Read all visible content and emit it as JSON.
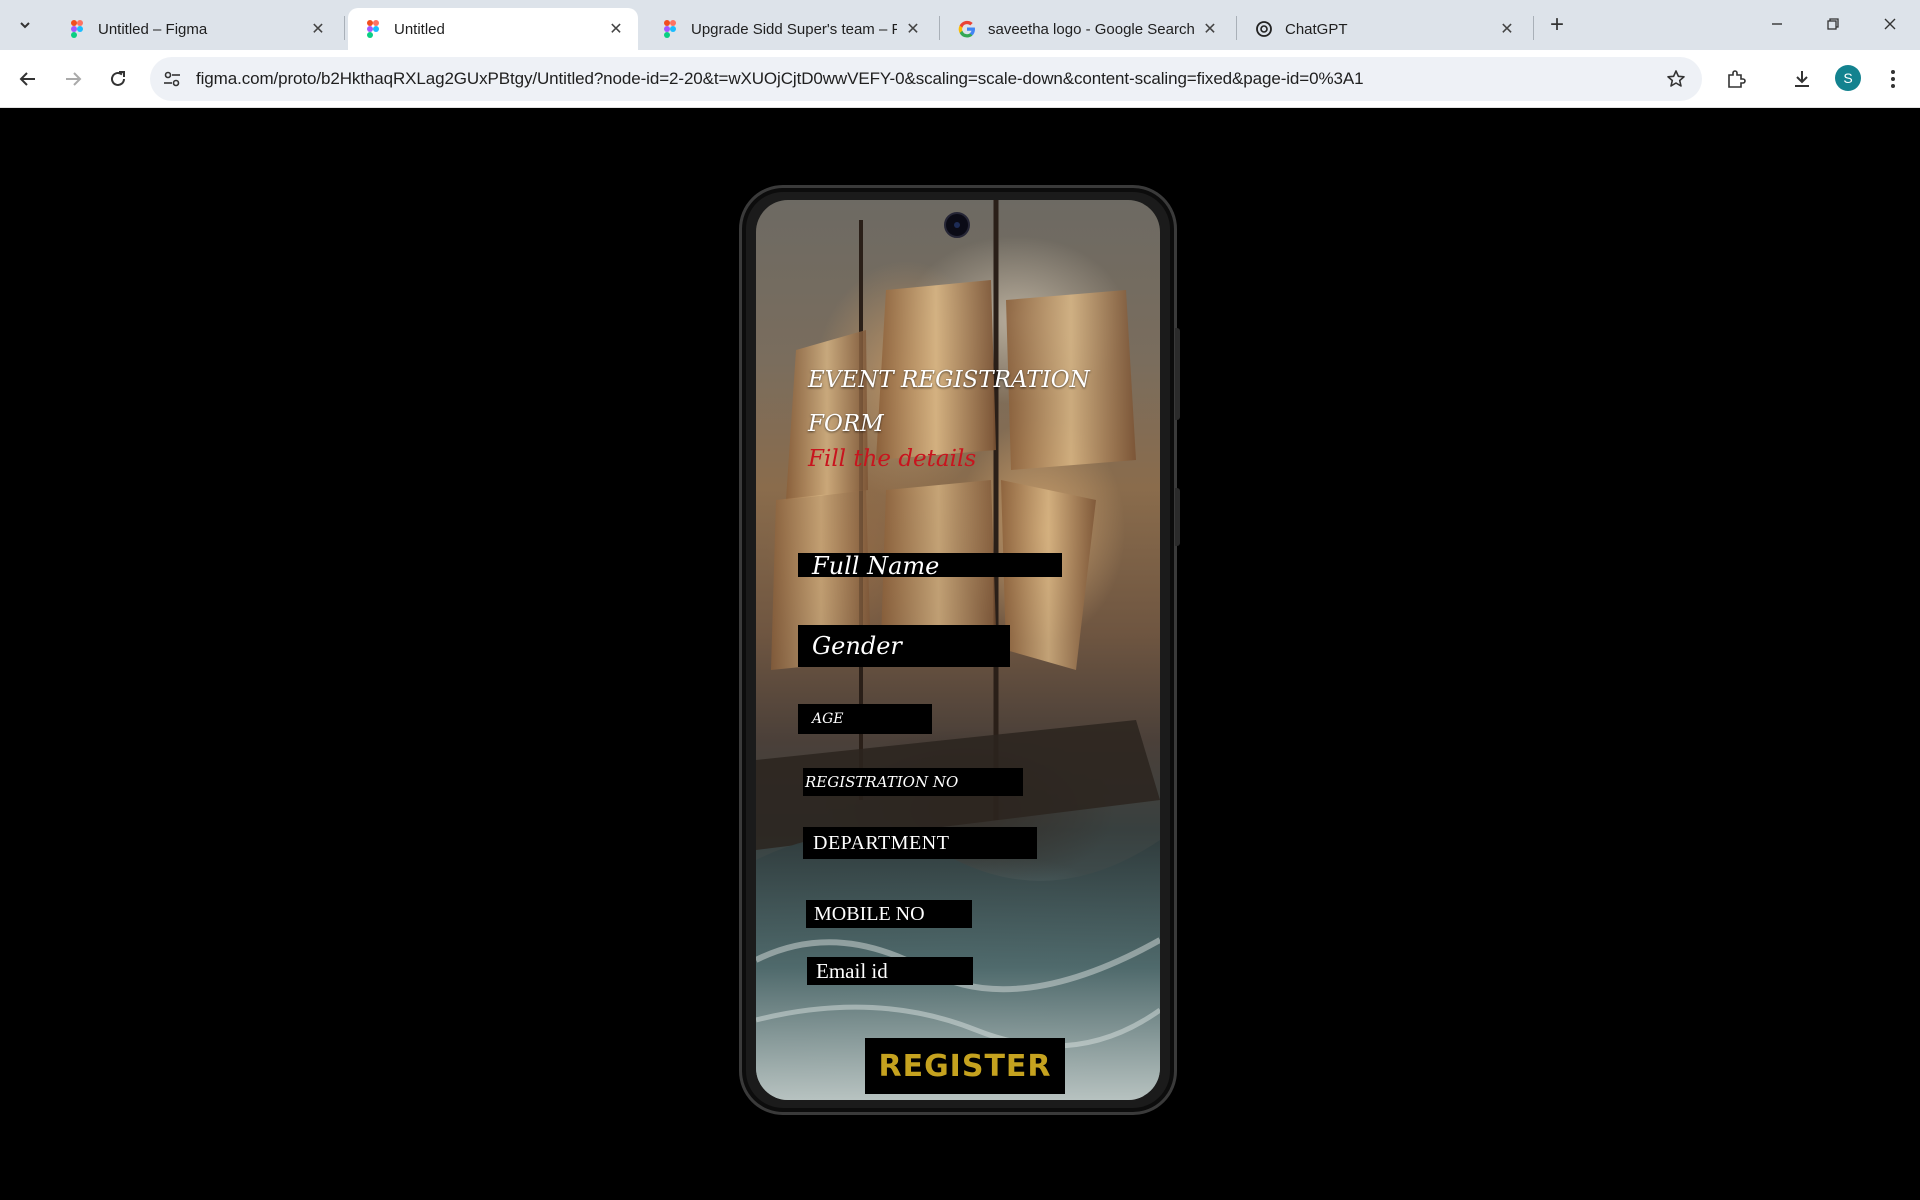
{
  "browser": {
    "tabs": [
      {
        "title": "Untitled – Figma",
        "icon": "figma-icon",
        "active": false
      },
      {
        "title": "Untitled",
        "icon": "figma-icon",
        "active": true
      },
      {
        "title": "Upgrade Sidd Super's team – Fi",
        "icon": "figma-icon",
        "active": false
      },
      {
        "title": "saveetha logo - Google Search",
        "icon": "google-icon",
        "active": false
      },
      {
        "title": "ChatGPT",
        "icon": "chatgpt-icon",
        "active": false
      }
    ],
    "url": "figma.com/proto/b2HkthaqRXLag2GUxPBtgy/Untitled?node-id=2-20&t=wXUOjCjtD0wwVEFY-0&scaling=scale-down&content-scaling=fixed&page-id=0%3A1",
    "profile_initial": "S",
    "colors": {
      "tabstrip": "#dde3ea",
      "profile": "#13828f"
    }
  },
  "form": {
    "title": "EVENT REGISTRATION FORM",
    "subtitle": "Fill the details",
    "fields": {
      "full_name": "Full Name",
      "gender": "Gender",
      "age": "AGE",
      "registration_no": "REGISTRATION NO",
      "department": "DEPARTMENT",
      "mobile_no": "MOBILE NO",
      "email": "Email id"
    },
    "register_label": "REGISTER",
    "colors": {
      "subtitle": "#c8141e",
      "register_text": "#c5a21f",
      "field_bg": "#000000"
    }
  }
}
